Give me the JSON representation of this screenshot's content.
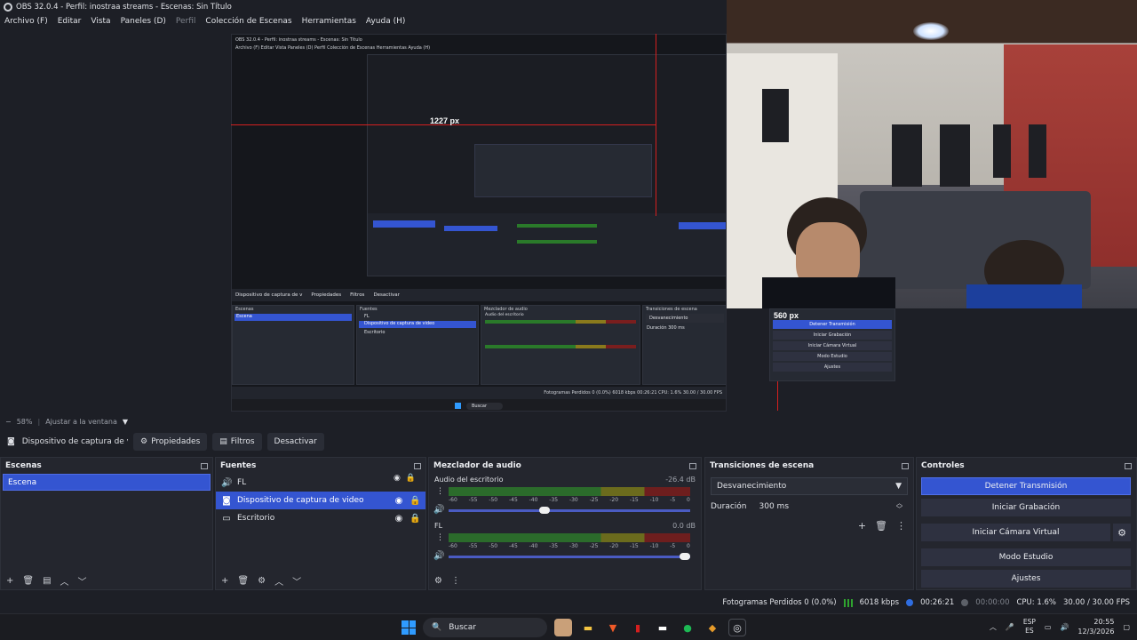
{
  "window": {
    "title": "OBS 32.0.4 - Perfil: inostraa streams - Escenas: Sin Título"
  },
  "menu": [
    {
      "label": "Archivo (F)",
      "enabled": true
    },
    {
      "label": "Editar",
      "enabled": true
    },
    {
      "label": "Vista",
      "enabled": true
    },
    {
      "label": "Paneles (D)",
      "enabled": true
    },
    {
      "label": "Perfil",
      "enabled": false
    },
    {
      "label": "Colección de Escenas",
      "enabled": true
    },
    {
      "label": "Herramientas",
      "enabled": true
    },
    {
      "label": "Ayuda (H)",
      "enabled": true
    }
  ],
  "preview": {
    "overlay_labels": {
      "width_label": "1227 px",
      "height_label": "560 px"
    },
    "nested_title": "OBS 32.0.4 - Perfil: inostraa streams - Escenas: Sin Título",
    "nested_menu": "Archivo (F)  Editar  Vista  Paneles (D)  Perfil  Colección de Escenas  Herramientas  Ayuda (H)",
    "nested_toolbar": {
      "source": "Dispositivo de captura de v",
      "properties": "Propiedades",
      "filters": "Filtros",
      "deactivate": "Desactivar",
      "zoom": "58%",
      "fit": "Ajustar a la ventana"
    },
    "nested_docks": {
      "scenes": "Escenas",
      "scene": "Escena",
      "sources": "Fuentes",
      "src1": "FL",
      "src2": "Dispositivo de captura de video",
      "src3": "Escritorio",
      "mixer": "Mezclador de audio",
      "mixer_ch": "Audio del escritorio",
      "transitions": "Transiciones de escena",
      "fade": "Desvanecimiento",
      "duration": "Duración",
      "duration_val": "300 ms",
      "controls": "Controles",
      "stop": "Detener Transmisión",
      "record": "Iniciar Grabación",
      "vcam": "Iniciar Cámara Virtual",
      "studio": "Modo Estudio",
      "settings": "Ajustes",
      "status": "Fotogramas Perdidos 0 (0.0%)   6018 kbps   00:26:21   CPU: 1.6%   30.00 / 30.00 FPS",
      "taskbar_search": "Buscar"
    }
  },
  "zoom": {
    "level": "58%",
    "fit_label": "Ajustar a la ventana"
  },
  "source_toolbar": {
    "source_name": "Dispositivo de captura de v",
    "properties": "Propiedades",
    "filters": "Filtros",
    "deactivate": "Desactivar"
  },
  "scenes": {
    "title": "Escenas",
    "items": [
      {
        "label": "Escena",
        "selected": true
      }
    ]
  },
  "sources": {
    "title": "Fuentes",
    "items": [
      {
        "label": "FL",
        "icon": "speaker-icon",
        "selected": false
      },
      {
        "label": "Dispositivo de captura de video",
        "icon": "camera-icon",
        "selected": true
      },
      {
        "label": "Escritorio",
        "icon": "monitor-icon",
        "selected": false
      }
    ]
  },
  "mixer": {
    "title": "Mezclador de audio",
    "channels": [
      {
        "name": "Audio del escritorio",
        "db": "-26.4 dB",
        "volume_fraction": 0.42
      },
      {
        "name": "FL",
        "db": "0.0 dB",
        "volume_fraction": 1.0
      }
    ],
    "ticks": [
      "-60",
      "-55",
      "-50",
      "-45",
      "-40",
      "-35",
      "-30",
      "-25",
      "-20",
      "-15",
      "-10",
      "-5",
      "0"
    ]
  },
  "transitions": {
    "title": "Transiciones de escena",
    "selected": "Desvanecimiento",
    "duration_label": "Duración",
    "duration_value": "300 ms"
  },
  "controls": {
    "title": "Controles",
    "stop_stream": "Detener Transmisión",
    "start_recording": "Iniciar Grabación",
    "start_virtual_cam": "Iniciar Cámara Virtual",
    "studio_mode": "Modo Estudio",
    "settings": "Ajustes"
  },
  "status": {
    "dropped_frames": "Fotogramas Perdidos 0 (0.0%)",
    "bitrate": "6018 kbps",
    "stream_time": "00:26:21",
    "record_time": "00:00:00",
    "cpu": "CPU: 1.6%",
    "fps": "30.00 / 30.00 FPS",
    "colors": {
      "live": "#2f6de1",
      "bitrate": "#2fa52f"
    }
  },
  "taskbar": {
    "search": "Buscar",
    "lang_top": "ESP",
    "lang_bottom": "ES",
    "time": "20:55",
    "date": "12/3/2026"
  },
  "colors": {
    "accent": "#3455d1",
    "background": "#1d1f26",
    "dock": "#24262e",
    "guide_red": "#d41f1f"
  }
}
